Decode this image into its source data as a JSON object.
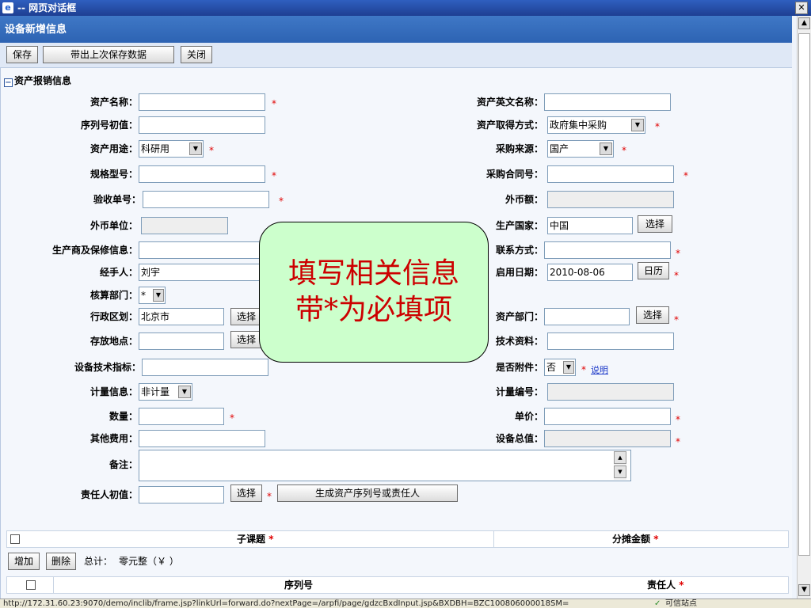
{
  "window": {
    "title": "-- 网页对话框",
    "close_glyph": "✕"
  },
  "header": {
    "title": "设备新增信息"
  },
  "toolbar": {
    "save": "保存",
    "load_last": "带出上次保存数据",
    "close": "关闭"
  },
  "section": {
    "title": "资产报销信息"
  },
  "form_left": {
    "asset_name": {
      "label": "资产名称：",
      "value": ""
    },
    "serial_start": {
      "label": "序列号初值：",
      "value": ""
    },
    "asset_use": {
      "label": "资产用途：",
      "value": "科研用"
    },
    "spec_model": {
      "label": "规格型号：",
      "value": ""
    },
    "acceptance_no": {
      "label": "验收单号：",
      "value": ""
    },
    "currency_unit": {
      "label": "外币单位：",
      "value": ""
    },
    "manufacturer": {
      "label": "生产商及保修信息：",
      "value": ""
    },
    "handler": {
      "label": "经手人：",
      "value": "刘宇"
    },
    "accounting_dept": {
      "label": "核算部门：",
      "value": "*"
    },
    "region": {
      "label": "行政区划：",
      "value": "北京市",
      "button": "选择"
    },
    "location": {
      "label": "存放地点：",
      "value": "",
      "button": "选择"
    },
    "tech_spec": {
      "label": "设备技术指标：",
      "value": ""
    },
    "measure_info": {
      "label": "计量信息：",
      "value": "非计量"
    },
    "quantity": {
      "label": "数量：",
      "value": ""
    },
    "other_fee": {
      "label": "其他费用：",
      "value": ""
    },
    "remark": {
      "label": "备注：",
      "value": ""
    },
    "owner_init": {
      "label": "责任人初值：",
      "value": "",
      "button": "选择"
    },
    "generate_btn": "生成资产序列号或责任人"
  },
  "form_right": {
    "asset_en_name": {
      "label": "资产英文名称：",
      "value": ""
    },
    "acquire_method": {
      "label": "资产取得方式：",
      "value": "政府集中采购"
    },
    "purchase_source": {
      "label": "采购来源：",
      "value": "国产"
    },
    "purchase_contract": {
      "label": "采购合同号：",
      "value": ""
    },
    "foreign_amount": {
      "label": "外币额：",
      "value": ""
    },
    "origin_country": {
      "label": "生产国家：",
      "value": "中国",
      "button": "选择"
    },
    "contact": {
      "label": "联系方式：",
      "value": ""
    },
    "start_date": {
      "label": "启用日期：",
      "value": "2010-08-06",
      "button": "日历"
    },
    "asset_dept": {
      "label": "资产部门：",
      "value": "",
      "button": "选择"
    },
    "tech_docs": {
      "label": "技术资料：",
      "value": ""
    },
    "has_attachment": {
      "label": "是否附件：",
      "value": "否",
      "link": "说明"
    },
    "measure_no": {
      "label": "计量编号：",
      "value": ""
    },
    "unit_price": {
      "label": "单价：",
      "value": ""
    },
    "total_value": {
      "label": "设备总值：",
      "value": ""
    }
  },
  "required_mark": "*",
  "callout": {
    "line1": "填写相关信息",
    "line2": "带*为必填项"
  },
  "subtable": {
    "col_subject": "子课题",
    "col_amount": "分摊金额",
    "add": "增加",
    "delete": "删除",
    "total_label": "总计：",
    "total_value": "零元整（￥ ）",
    "col_serial": "序列号",
    "col_owner": "责任人"
  },
  "status": {
    "url": "http://172.31.60.23:9070/demo/inclib/frame.jsp?linkUrl=forward.do?nextPage=/arpfi/page/gdzcBxdInput.jsp&BXDBH=BZC100806000018SM=",
    "zone": "可信站点"
  }
}
